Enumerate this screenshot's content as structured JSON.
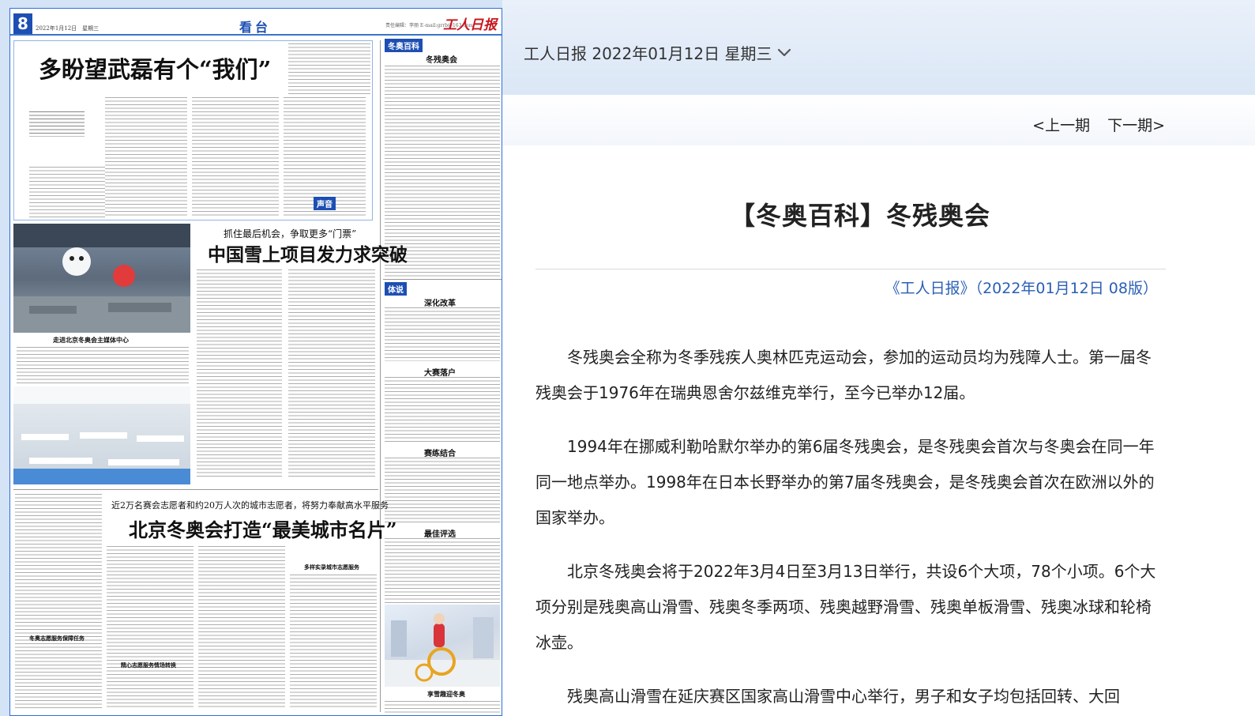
{
  "issue_selector": {
    "label": "工人日报 2022年01月12日 星期三"
  },
  "nav": {
    "prev": "<上一期",
    "next": "下一期>"
  },
  "article": {
    "title": "【冬奥百科】冬残奥会",
    "source": "《工人日报》（2022年01月12日 08版）",
    "paragraphs": [
      "冬残奥会全称为冬季残疾人奥林匹克运动会，参加的运动员均为残障人士。第一届冬残奥会于1976年在瑞典恩舍尔兹维克举行，至今已举办12届。",
      "1994年在挪威利勒哈默尔举办的第6届冬残奥会，是冬残奥会首次与冬奥会在同一年同一地点举办。1998年在日本长野举办的第7届冬残奥会，是冬残奥会首次在欧洲以外的国家举办。",
      "北京冬残奥会将于2022年3月4日至3月13日举行，共设6个大项，78个小项。6个大项分别是残奥高山滑雪、残奥冬季两项、残奥越野滑雪、残奥单板滑雪、残奥冰球和轮椅冰壶。",
      "残奥高山滑雪在延庆赛区国家高山滑雪中心举行，男子和女子均包括回转、大回"
    ]
  },
  "newspaper": {
    "page_number": "8",
    "date_line": "2022年1月12日　星期三",
    "section": "看台",
    "masthead_info": "责任编辑：李丽  E-mail:grrb@163.com",
    "logo": "工人日报",
    "headline_1": "多盼望武磊有个“我们”",
    "headline_2_kicker": "抓住最后机会，争取更多“门票”",
    "headline_2": "中国雪上项目发力求突破",
    "headline_3_kicker": "近2万名赛会志愿者和约20万人次的城市志愿者，将努力奉献高水平服务",
    "headline_3": "北京冬奥会打造“最美城市名片”",
    "caption_photo": "走进北京冬奥会主媒体中心",
    "caption_bottom": "享雪趣迎冬奥",
    "column_tags": {
      "baike": "冬奥百科",
      "shengyin": "声音",
      "tishuo": "体说"
    },
    "column_subheads": {
      "dongcan": "冬残奥会",
      "shendu": "深化改革",
      "dasai": "大赛落户",
      "saijie": "赛练结合",
      "zuijia": "最佳评选",
      "duozhong": "多样实录城市志愿服务",
      "dongji": "冬奥志愿服务保障任务",
      "jingxin": "精心志愿服务情场转换"
    },
    "colors": {
      "brand_red": "#c8171e",
      "brand_blue": "#1d4fb3"
    }
  }
}
